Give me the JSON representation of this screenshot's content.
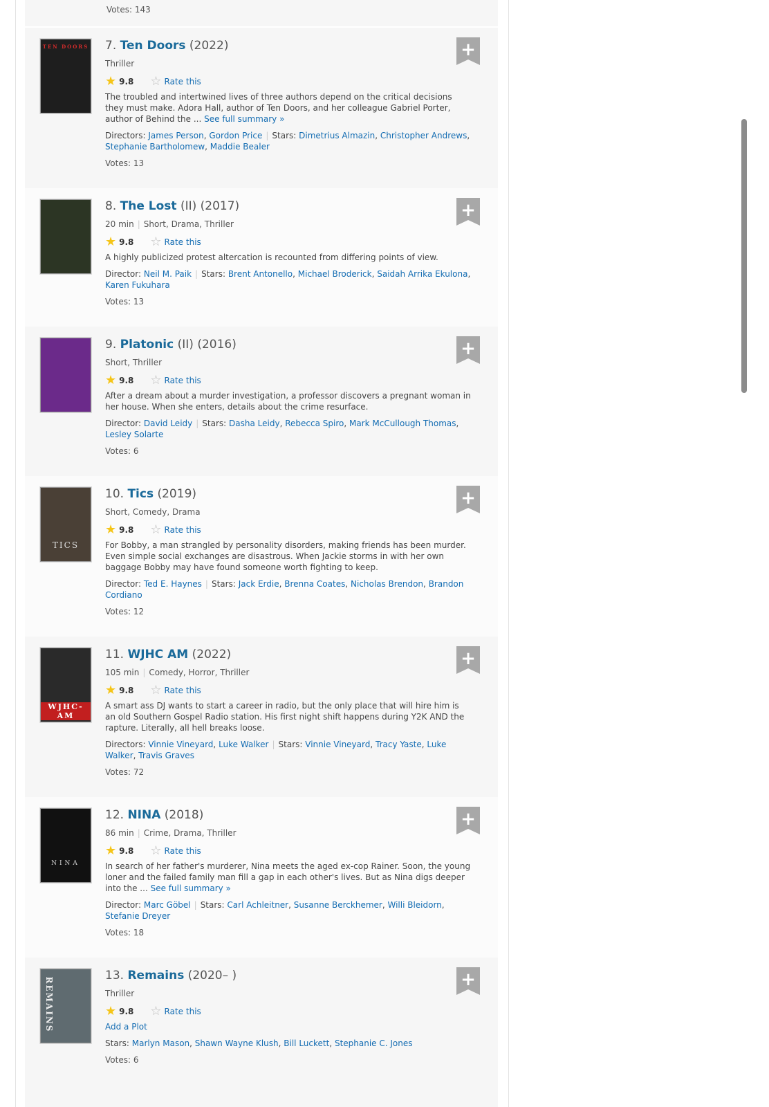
{
  "previous_votes": "Votes: 143",
  "rate_label": "Rate this",
  "items": [
    {
      "number": "7.",
      "title": "Ten Doors",
      "extra": "",
      "year": "(2022)",
      "runtime": "",
      "genres": "Thriller",
      "rating": "9.8",
      "plot": "The troubled and intertwined lives of three authors depend on the critical decisions they must make. Adora Hall, author of Ten Doors, and her colleague Gabriel Porter, author of Behind the ...",
      "plot_link": "See full summary »",
      "directors_label": "Directors:",
      "directors": [
        "James Person",
        "Gordon Price"
      ],
      "stars_label": "Stars:",
      "stars": [
        "Dimetrius Almazin",
        "Christopher Andrews",
        "Stephanie Bartholomew",
        "Maddie Bealer"
      ],
      "votes": "Votes: 13",
      "poster_text": "TEN DOORS",
      "poster_color": "#1e1e1e"
    },
    {
      "number": "8.",
      "title": "The Lost",
      "extra": "(II)",
      "year": "(2017)",
      "runtime": "20 min",
      "genres": "Short, Drama, Thriller",
      "rating": "9.8",
      "plot": "A highly publicized protest altercation is recounted from differing points of view.",
      "plot_link": "",
      "directors_label": "Director:",
      "directors": [
        "Neil M. Paik"
      ],
      "stars_label": "Stars:",
      "stars": [
        "Brent Antonello",
        "Michael Broderick",
        "Saidah Arrika Ekulona",
        "Karen Fukuhara"
      ],
      "votes": "Votes: 13",
      "poster_text": "",
      "poster_color": "#2c3524"
    },
    {
      "number": "9.",
      "title": "Platonic",
      "extra": "(II)",
      "year": "(2016)",
      "runtime": "",
      "genres": "Short, Thriller",
      "rating": "9.8",
      "plot": "After a dream about a murder investigation, a professor discovers a pregnant woman in her house. When she enters, details about the crime resurface.",
      "plot_link": "",
      "directors_label": "Director:",
      "directors": [
        "David Leidy"
      ],
      "stars_label": "Stars:",
      "stars": [
        "Dasha Leidy",
        "Rebecca Spiro",
        "Mark McCullough Thomas",
        "Lesley Solarte"
      ],
      "votes": "Votes: 6",
      "poster_text": "",
      "poster_color": "#6b2a8a"
    },
    {
      "number": "10.",
      "title": "Tics",
      "extra": "",
      "year": "(2019)",
      "runtime": "",
      "genres": "Short, Comedy, Drama",
      "rating": "9.8",
      "plot": "For Bobby, a man strangled by personality disorders, making friends has been murder. Even simple social exchanges are disastrous. When Jackie storms in with her own baggage Bobby may have found someone worth fighting to keep.",
      "plot_link": "",
      "directors_label": "Director:",
      "directors": [
        "Ted E. Haynes"
      ],
      "stars_label": "Stars:",
      "stars": [
        "Jack Erdie",
        "Brenna Coates",
        "Nicholas Brendon",
        "Brandon Cordiano"
      ],
      "votes": "Votes: 12",
      "poster_text": "TICS",
      "poster_color": "#4a4036"
    },
    {
      "number": "11.",
      "title": "WJHC AM",
      "extra": "",
      "year": "(2022)",
      "runtime": "105 min",
      "genres": "Comedy, Horror, Thriller",
      "rating": "9.8",
      "plot": "A smart ass DJ wants to start a career in radio, but the only place that will hire him is an old Southern Gospel Radio station. His first night shift happens during Y2K AND the rapture. Literally, all hell breaks loose.",
      "plot_link": "",
      "directors_label": "Directors:",
      "directors": [
        "Vinnie Vineyard",
        "Luke Walker"
      ],
      "stars_label": "Stars:",
      "stars": [
        "Vinnie Vineyard",
        "Tracy Yaste",
        "Luke Walker",
        "Travis Graves"
      ],
      "votes": "Votes: 72",
      "poster_text": "WJHC-AM",
      "poster_color": "#2a2a2a"
    },
    {
      "number": "12.",
      "title": "NINA",
      "extra": "",
      "year": "(2018)",
      "runtime": "86 min",
      "genres": "Crime, Drama, Thriller",
      "rating": "9.8",
      "plot": "In search of her father's murderer, Nina meets the aged ex-cop Rainer. Soon, the young loner and the failed family man fill a gap in each other's lives. But as Nina digs deeper into the ...",
      "plot_link": "See full summary »",
      "directors_label": "Director:",
      "directors": [
        "Marc Göbel"
      ],
      "stars_label": "Stars:",
      "stars": [
        "Carl Achleitner",
        "Susanne Berckhemer",
        "Willi Bleidorn",
        "Stefanie Dreyer"
      ],
      "votes": "Votes: 18",
      "poster_text": "NINA",
      "poster_color": "#111111"
    },
    {
      "number": "13.",
      "title": "Remains",
      "extra": "",
      "year": "(2020– )",
      "runtime": "",
      "genres": "Thriller",
      "rating": "9.8",
      "plot": "",
      "plot_link": "Add a Plot",
      "directors_label": "",
      "directors": [],
      "stars_label": "Stars:",
      "stars": [
        "Marlyn Mason",
        "Shawn Wayne Klush",
        "Bill Luckett",
        "Stephanie C. Jones"
      ],
      "votes": "Votes: 6",
      "poster_text": "REMAINS",
      "poster_color": "#5f6b70"
    }
  ]
}
